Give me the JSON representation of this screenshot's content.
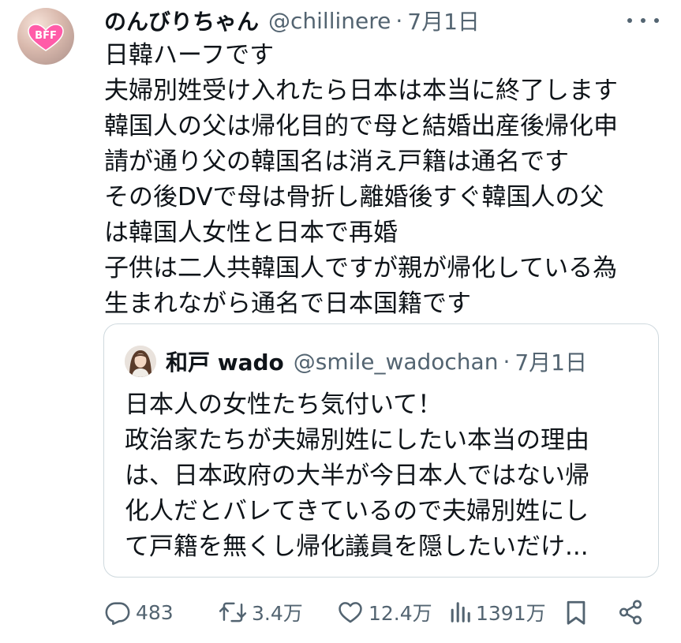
{
  "tweet": {
    "author_name": "のんびりちゃん",
    "handle": "@chillinere",
    "separator": "·",
    "date": "7月1日",
    "avatar_text": "BFF",
    "lines": [
      "日韓ハーフです",
      "夫婦別姓受け入れたら日本は本当に終了します",
      "韓国人の父は帰化目的で母と結婚出産後帰化申",
      "請が通り父の韓国名は消え戸籍は通名です",
      "その後DVで母は骨折し離婚後すぐ韓国人の父",
      "は韓国人女性と日本で再婚",
      "子供は二人共韓国人ですが親が帰化している為",
      "生まれながら通名で日本国籍です"
    ]
  },
  "quote": {
    "author_name": "和戸 wado",
    "handle": "@smile_wadochan",
    "separator": "·",
    "date": "7月1日",
    "lines": [
      "日本人の女性たち気付いて！",
      "政治家たちが夫婦別姓にしたい本当の理由",
      "は、日本政府の大半が今日本人ではない帰",
      "化人だとバレてきているので夫婦別姓にし",
      "て戸籍を無くし帰化議員を隠したいだけ..."
    ]
  },
  "actions": {
    "replies": "483",
    "reposts": "3.4万",
    "likes": "12.4万",
    "views": "1391万"
  },
  "icons": [
    "more-icon",
    "reply-icon",
    "repost-icon",
    "like-icon",
    "views-icon",
    "bookmark-icon",
    "share-icon"
  ],
  "colors": {
    "text": "#0f1419",
    "secondary": "#536471",
    "border": "#cfd9de",
    "heart": "#ff4fa0"
  }
}
